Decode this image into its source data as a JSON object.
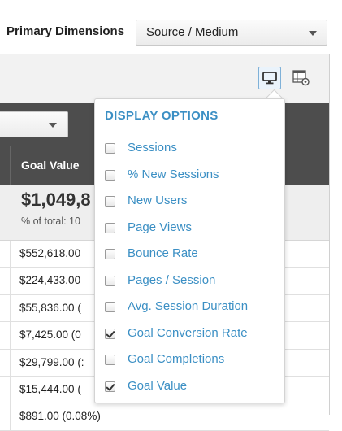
{
  "filters": {
    "primary_dimensions_label": "Primary Dimensions",
    "primary_dimension_value": "Source / Medium"
  },
  "table": {
    "column_header": "Goal Value",
    "summary_total": "$1,049,8",
    "summary_percent": "% of total: 10",
    "rows": [
      "$552,618.00",
      "$224,433.00",
      "$55,836.00 (",
      "$7,425.00 (0",
      "$29,799.00 (:",
      "$15,444.00 (",
      "$891.00 (0.08%)"
    ]
  },
  "display_options": {
    "title": "DISPLAY OPTIONS",
    "accent_color": "#3b8fc4",
    "options": [
      {
        "label": "Sessions",
        "checked": false
      },
      {
        "label": "% New Sessions",
        "checked": false
      },
      {
        "label": "New Users",
        "checked": false
      },
      {
        "label": "Page Views",
        "checked": false
      },
      {
        "label": "Bounce Rate",
        "checked": false
      },
      {
        "label": "Pages / Session",
        "checked": false
      },
      {
        "label": "Avg. Session Duration",
        "checked": false
      },
      {
        "label": "Goal Conversion Rate",
        "checked": true
      },
      {
        "label": "Goal Completions",
        "checked": false
      },
      {
        "label": "Goal Value",
        "checked": true
      }
    ]
  },
  "icons": {
    "display_options_button": "monitor-icon",
    "table_settings_button": "table-settings-icon"
  }
}
